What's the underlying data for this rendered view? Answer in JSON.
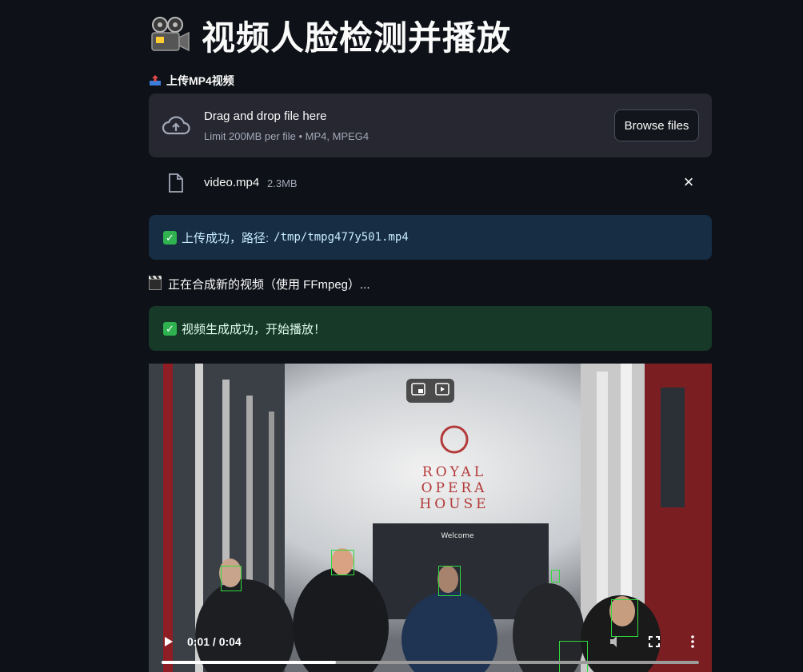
{
  "page": {
    "title": "视频人脸检测并播放",
    "title_icon": "movie-camera-icon"
  },
  "upload": {
    "label": "上传MP4视频",
    "label_icon": "inbox-tray-icon",
    "drop_title": "Drag and drop file here",
    "drop_sub": "Limit 200MB per file • MP4, MPEG4",
    "browse_label": "Browse files",
    "file_name": "video.mp4",
    "file_size": "2.3MB"
  },
  "alerts": {
    "upload_prefix": "上传成功，路径: ",
    "upload_path": "/tmp/tmpg477y501.mp4",
    "status_text": "正在合成新的视频（使用 FFmpeg）...",
    "done_text": "视频生成成功，开始播放！"
  },
  "video": {
    "sign_line1": "ROYAL",
    "sign_line2": "OPERA",
    "sign_line3": "HOUSE",
    "welcome": "Welcome",
    "time": "0:01 / 0:04",
    "progress": 0.325,
    "detection_color": "#2edb3d"
  },
  "colors": {
    "background": "#0e1117",
    "info_bg": "#172d43",
    "success_bg": "#173928",
    "dropzone_bg": "#262730"
  }
}
